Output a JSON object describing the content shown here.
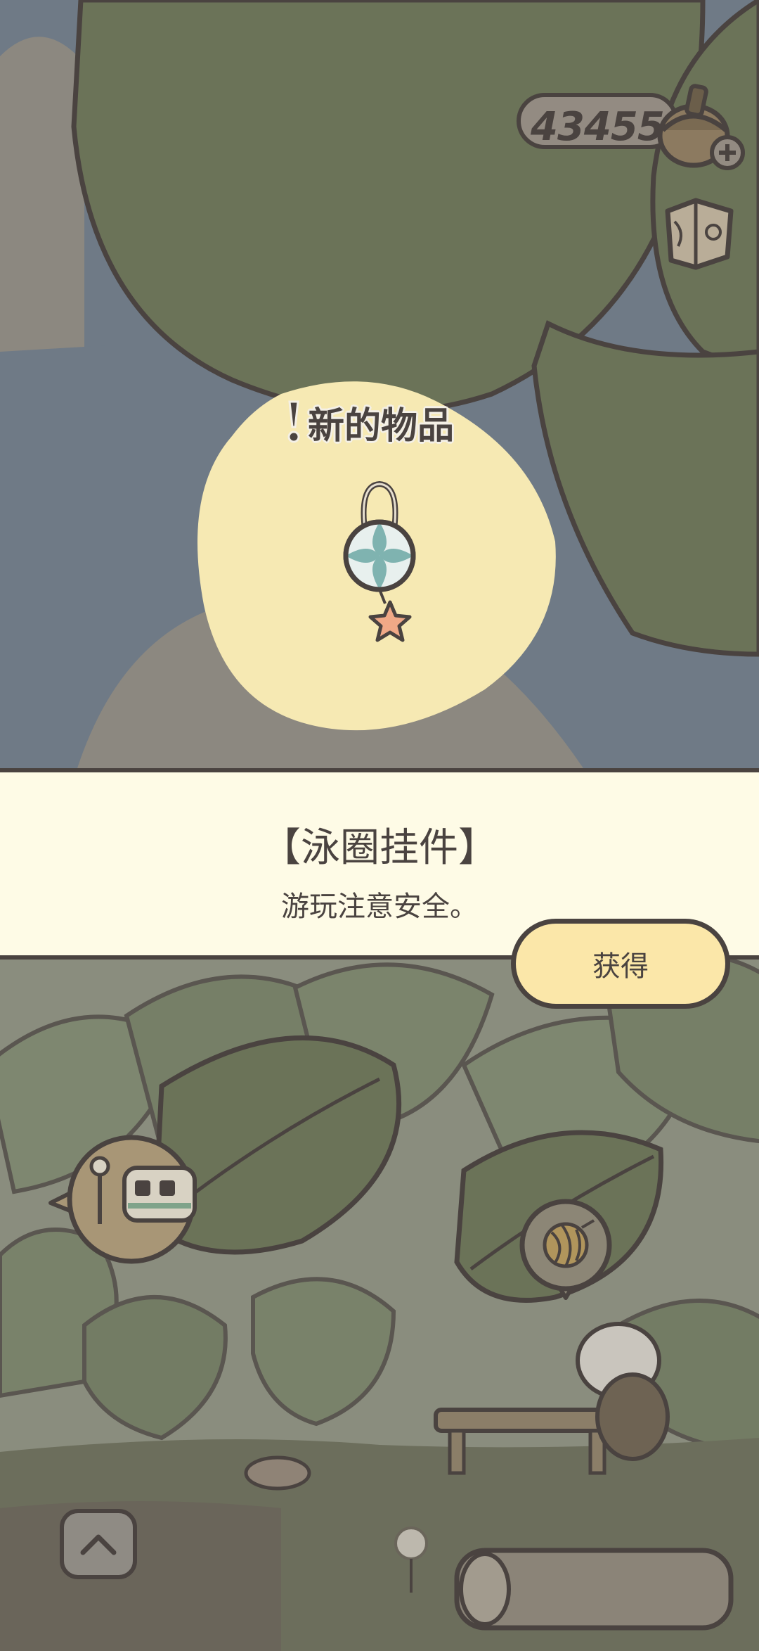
{
  "hud": {
    "currency_value": "434557",
    "currency_icon": "acorn-icon",
    "add_icon": "plus-icon",
    "map_icon": "map-icon"
  },
  "reward": {
    "new_item_label": "新的物品",
    "item_name": "【泳圈挂件】",
    "item_description": "游玩注意安全。",
    "get_button_label": "获得"
  },
  "scene": {
    "train_bubble_icon": "train-icon",
    "yarn_bubble_icon": "yarn-ball-icon",
    "up_button_icon": "chevron-up-icon"
  },
  "colors": {
    "outline": "#4a4340",
    "panel_bg": "#fefbe6",
    "button_bg": "#fbe7a9",
    "glow": "#f6e9b3",
    "foliage_dark": "#6b7358"
  }
}
